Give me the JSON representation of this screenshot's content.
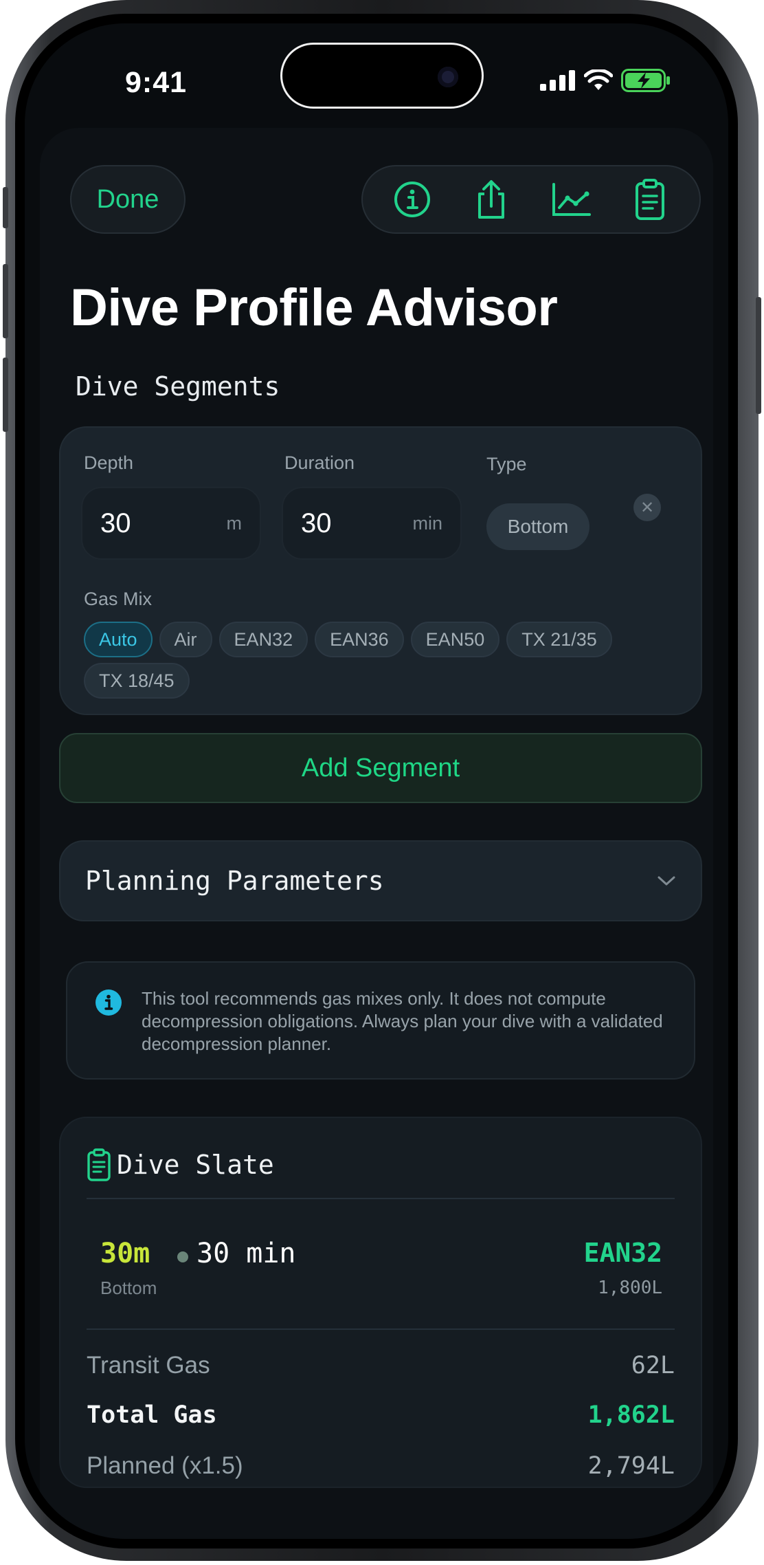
{
  "status": {
    "time": "9:41"
  },
  "header": {
    "done_label": "Done",
    "title": "Dive Profile Advisor"
  },
  "toolbar": {
    "icons": [
      "info-icon",
      "share-icon",
      "chart-icon",
      "clipboard-icon"
    ]
  },
  "segments_section": {
    "title": "Dive Segments",
    "segment": {
      "depth_label": "Depth",
      "depth_value": "30",
      "depth_unit": "m",
      "duration_label": "Duration",
      "duration_value": "30",
      "duration_unit": "min",
      "type_label": "Type",
      "type_value": "Bottom",
      "gas_label": "Gas Mix",
      "gas_options": [
        "Auto",
        "Air",
        "EAN32",
        "EAN36",
        "EAN50",
        "TX 21/35",
        "TX 18/45"
      ],
      "gas_selected": "Auto"
    },
    "add_label": "Add Segment"
  },
  "planning": {
    "title": "Planning Parameters"
  },
  "notice": {
    "text": "This tool recommends gas mixes only. It does not compute decompression obligations. Always plan your dive with a validated decompression planner."
  },
  "slate": {
    "title": "Dive Slate",
    "segment": {
      "depth": "30m",
      "duration": "30 min",
      "type": "Bottom",
      "gas": "EAN32",
      "volume": "1,800L"
    },
    "transit_label": "Transit Gas",
    "transit_value": "62L",
    "total_label": "Total Gas",
    "total_value": "1,862L",
    "planned_label": "Planned (x1.5)",
    "planned_value": "2,794L"
  },
  "colors": {
    "accent": "#22d38c",
    "depth": "#c8e63a",
    "selected_chip": "#3bc7e6",
    "background": "#0d1115"
  }
}
